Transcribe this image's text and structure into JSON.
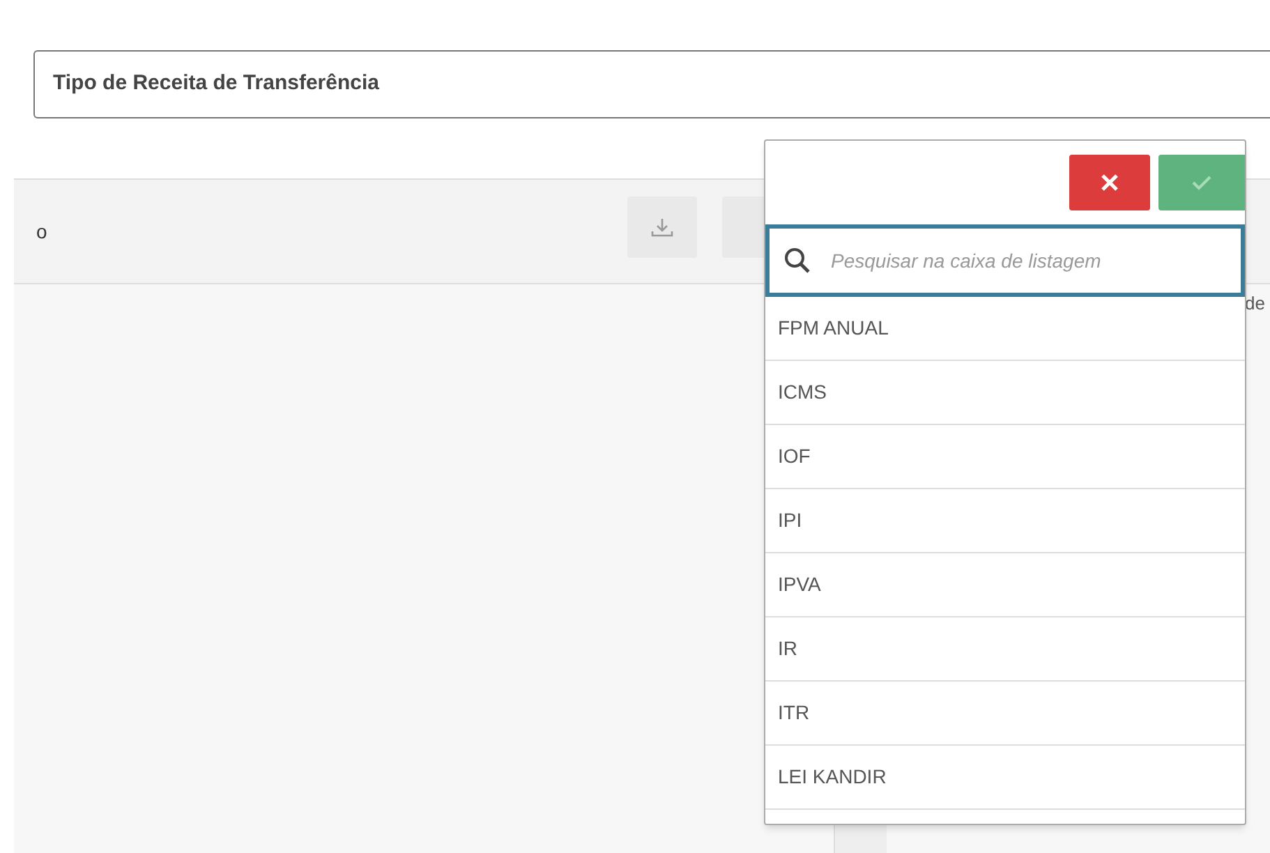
{
  "filter_field": {
    "title": "Tipo de Receita de Transferência"
  },
  "panel_header": {
    "title": "o",
    "side_text": "de"
  },
  "listbox": {
    "search_placeholder": "Pesquisar na caixa de listagem",
    "items": [
      {
        "label": "FPM ANUAL"
      },
      {
        "label": "ICMS"
      },
      {
        "label": "IOF"
      },
      {
        "label": "IPI"
      },
      {
        "label": "IPVA"
      },
      {
        "label": "IR"
      },
      {
        "label": "ITR"
      },
      {
        "label": "LEI KANDIR"
      }
    ]
  }
}
